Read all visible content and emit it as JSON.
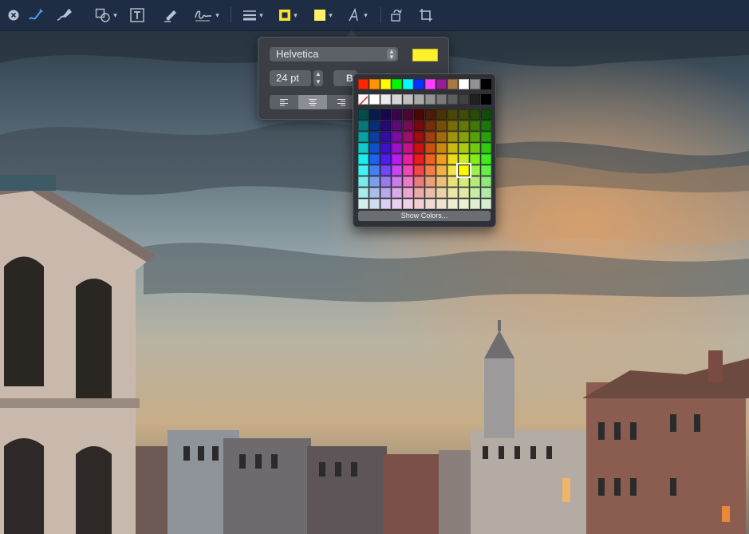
{
  "toolbar": {
    "tools": [
      "close-icon",
      "sketch-icon",
      "draw-icon",
      "shapes-icon",
      "text-box-icon",
      "highlight-icon",
      "sign-icon",
      "line-style-icon",
      "border-color-icon",
      "fill-color-icon",
      "text-style-icon",
      "rotate-icon",
      "crop-icon"
    ],
    "accent_color": "#4a9eff",
    "fill_color": "#fdf16a",
    "border_color": "#f6e52a"
  },
  "text_popover": {
    "font_name": "Helvetica",
    "font_size": "24 pt",
    "bold_label": "B",
    "text_color": "#fdf12e"
  },
  "color_palette": {
    "top_row": [
      "#ff2600",
      "#ff9300",
      "#fffb00",
      "#00f900",
      "#00fdff",
      "#0433ff",
      "#ff40ff",
      "#942192",
      "#aa7942",
      "#ffffff",
      "#929292",
      "#000000"
    ],
    "gray_row": [
      "none",
      "#ffffff",
      "#ebebeb",
      "#d6d6d6",
      "#c0c0c0",
      "#aaaaaa",
      "#929292",
      "#797979",
      "#5e5e5e",
      "#424242",
      "#212121",
      "#000000"
    ],
    "hue_columns": [
      "#0a4b5e",
      "#0b2e8a",
      "#2a0e7a",
      "#4b0d6e",
      "#5e0c3e",
      "#6b0f0f",
      "#6b2b05",
      "#6b4a00",
      "#6b6300",
      "#5b6b00",
      "#3e6a10",
      "#2a5a1a"
    ],
    "selected": "fffb00",
    "show_colors_label": "Show Colors..."
  }
}
